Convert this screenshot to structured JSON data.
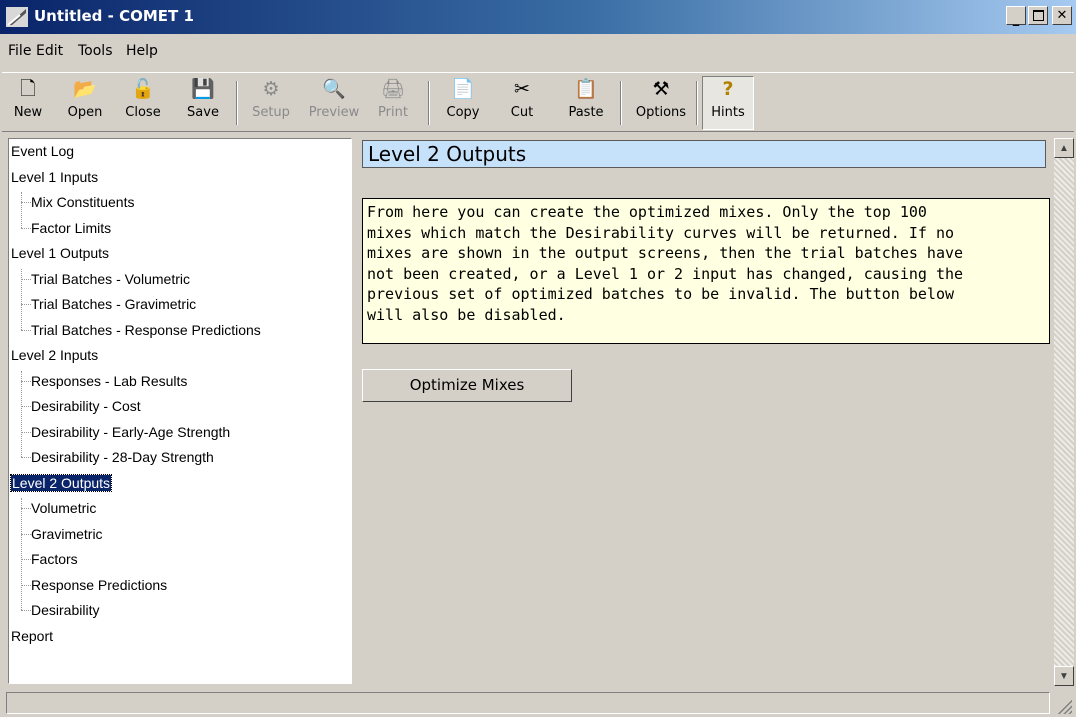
{
  "window": {
    "title": "Untitled - COMET 1"
  },
  "menu": [
    "File",
    "Edit",
    "Tools",
    "Help"
  ],
  "toolbar": {
    "new": "New",
    "open": "Open",
    "close": "Close",
    "save": "Save",
    "setup": "Setup",
    "preview": "Preview",
    "print": "Print",
    "copy": "Copy",
    "cut": "Cut",
    "paste": "Paste",
    "options": "Options",
    "hints": "Hints"
  },
  "tree": [
    {
      "label": "Event Log",
      "level": 0
    },
    {
      "label": "Level 1 Inputs",
      "level": 0
    },
    {
      "label": "Mix Constituents",
      "level": 1
    },
    {
      "label": "Factor Limits",
      "level": 1
    },
    {
      "label": "Level 1 Outputs",
      "level": 0
    },
    {
      "label": "Trial Batches - Volumetric",
      "level": 1
    },
    {
      "label": "Trial Batches - Gravimetric",
      "level": 1
    },
    {
      "label": "Trial Batches - Response Predictions",
      "level": 1
    },
    {
      "label": "Level 2 Inputs",
      "level": 0
    },
    {
      "label": "Responses - Lab Results",
      "level": 1
    },
    {
      "label": "Desirability - Cost",
      "level": 1
    },
    {
      "label": "Desirability - Early-Age Strength",
      "level": 1
    },
    {
      "label": "Desirability - 28-Day Strength",
      "level": 1
    },
    {
      "label": "Level 2 Outputs",
      "level": 0,
      "selected": true
    },
    {
      "label": "Volumetric",
      "level": 1
    },
    {
      "label": "Gravimetric",
      "level": 1
    },
    {
      "label": "Factors",
      "level": 1
    },
    {
      "label": "Response Predictions",
      "level": 1
    },
    {
      "label": "Desirability",
      "level": 1
    },
    {
      "label": "Report",
      "level": 0
    }
  ],
  "content": {
    "heading": "Level 2 Outputs",
    "info_lines": [
      "From here you can create the optimized mixes. Only the top 100",
      "mixes which match the Desirability curves will be returned. If no",
      "mixes are shown in the output screens, then the trial batches have",
      "not been created, or a Level 1 or 2 input has changed, causing the",
      "previous set of optimized batches to be invalid. The button below",
      "will also be disabled."
    ],
    "optimize_button": "Optimize Mixes"
  },
  "colors": {
    "title_active": "#0a246a",
    "heading_bg": "#c6e2fb",
    "info_bg": "#ffffe1",
    "selection": "#0a246a"
  }
}
